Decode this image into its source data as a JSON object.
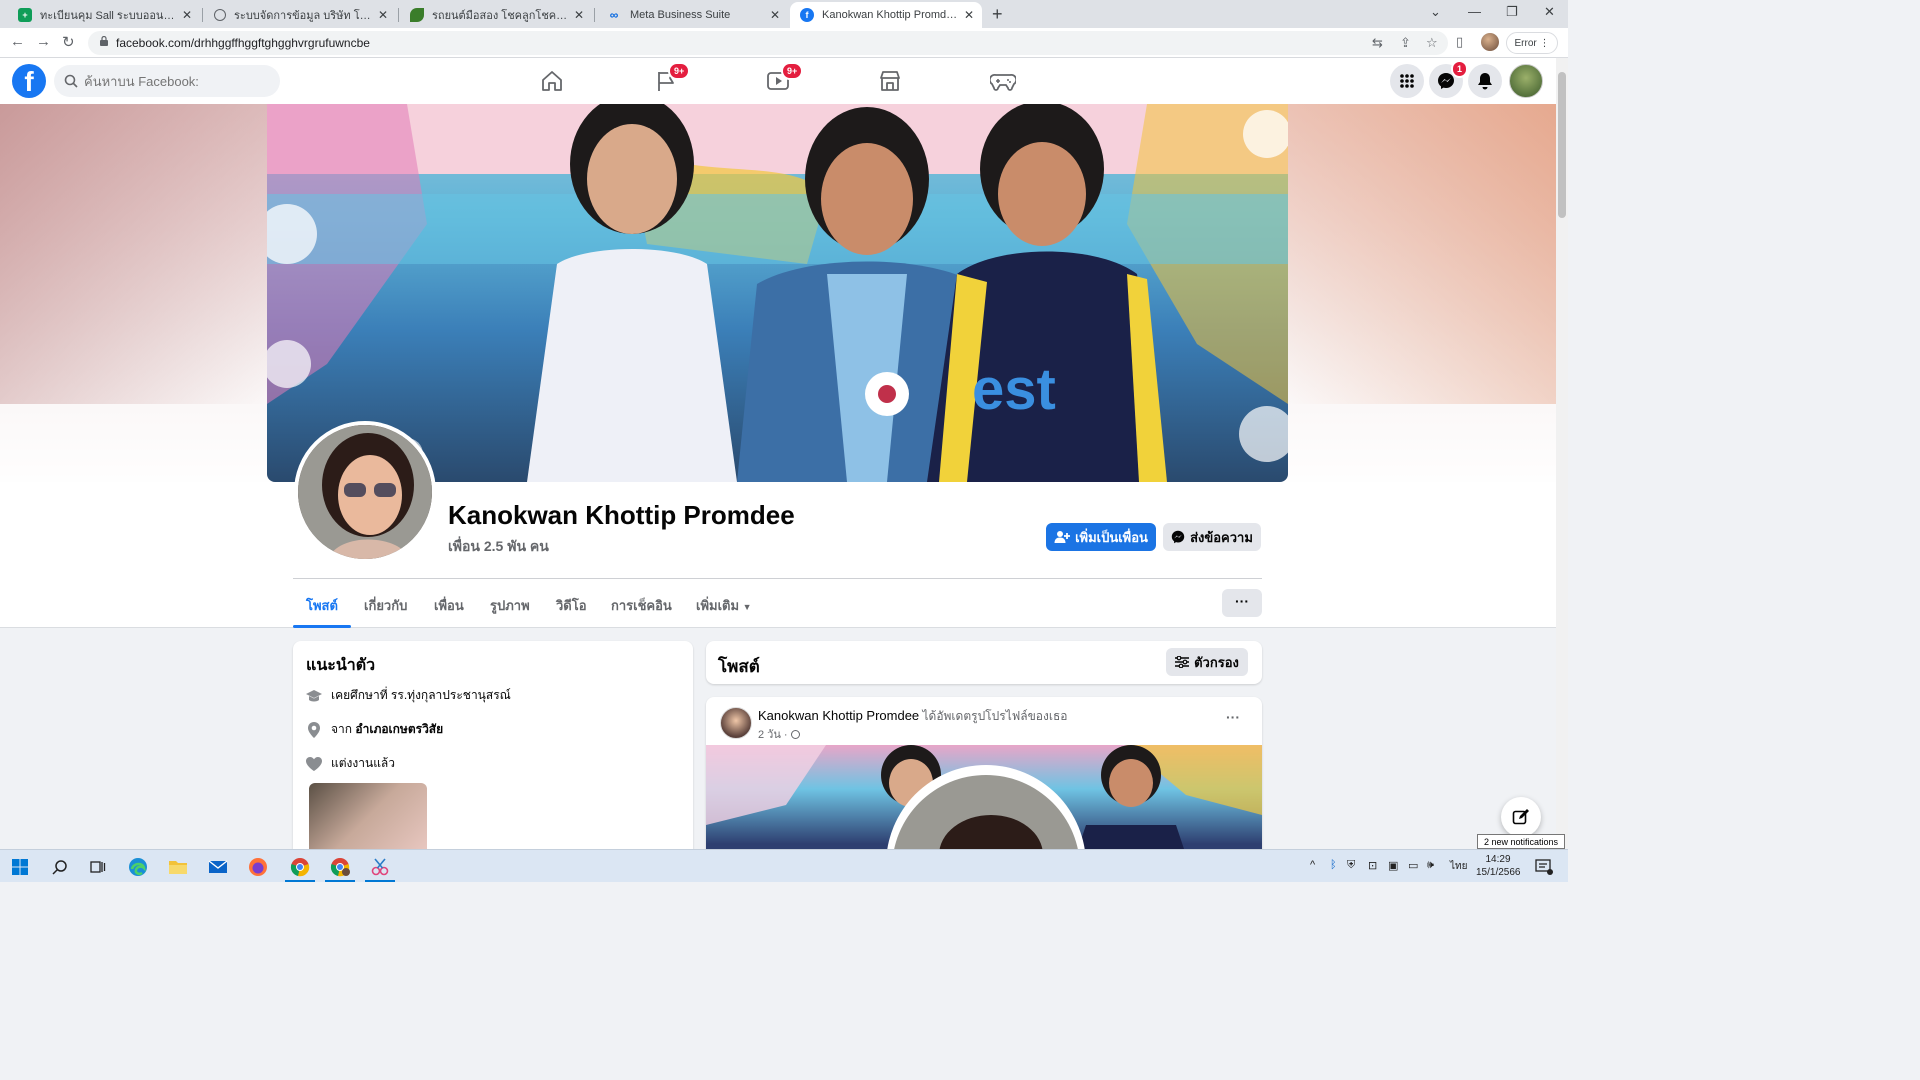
{
  "browser": {
    "tabs": [
      {
        "title": "ทะเบียนคุม Sall ระบบออนไลน์.xlsx - G",
        "icon": "sheets-icon",
        "color": "#0f9d58"
      },
      {
        "title": "ระบบจัดการข้อมูล บริษัท โชคลูกโชค อ",
        "icon": "globe-icon",
        "color": "#5f6368"
      },
      {
        "title": "รถยนต์มือสอง โชคลูกโชค อุดรธานี",
        "icon": "leaf-icon",
        "color": "#3a7d2a"
      },
      {
        "title": "Meta Business Suite",
        "icon": "meta-icon",
        "color": "#0064e0"
      },
      {
        "title": "Kanokwan Khottip Promdee | Fac",
        "icon": "facebook-icon",
        "color": "#1877f2"
      }
    ],
    "url": "facebook.com/drhhggffhggftghgghvrgrufuwncbe",
    "error_label": "Error"
  },
  "fb": {
    "search_placeholder": "ค้นหาบน Facebook:",
    "badges": {
      "pages": "9+",
      "watch": "9+",
      "messenger": "1"
    }
  },
  "profile": {
    "name": "Kanokwan Khottip Promdee",
    "friends": "เพื่อน 2.5 พัน คน",
    "add_friend_label": "เพิ่มเป็นเพื่อน",
    "message_label": "ส่งข้อความ",
    "tabs": [
      "โพสต์",
      "เกี่ยวกับ",
      "เพื่อน",
      "รูปภาพ",
      "วิดีโอ",
      "การเช็คอิน",
      "เพิ่มเติม"
    ],
    "more_button": "···"
  },
  "intro": {
    "title": "แนะนำตัว",
    "studied": "เคยศึกษาที่ รร.ทุ่งกุลาประชานุสรณ์",
    "from_prefix": "จาก ",
    "from_place": "อำเภอเกษตรวิสัย",
    "relationship": "แต่งงานแล้ว"
  },
  "posts": {
    "title": "โพสต์",
    "filter_label": "ตัวกรอง",
    "post": {
      "author": "Kanokwan Khottip Promdee",
      "action": " ได้อัพเดตรูปโปรไฟล์ของเธอ",
      "time": "2 วัน · ",
      "dots": "···"
    }
  },
  "tooltip": "2 new notifications",
  "taskbar": {
    "clock_time": "14:29",
    "clock_date": "15/1/2566",
    "language": "ไทย"
  },
  "colors": {
    "fb_blue": "#1877f2",
    "badge_red": "#e41e3f"
  }
}
